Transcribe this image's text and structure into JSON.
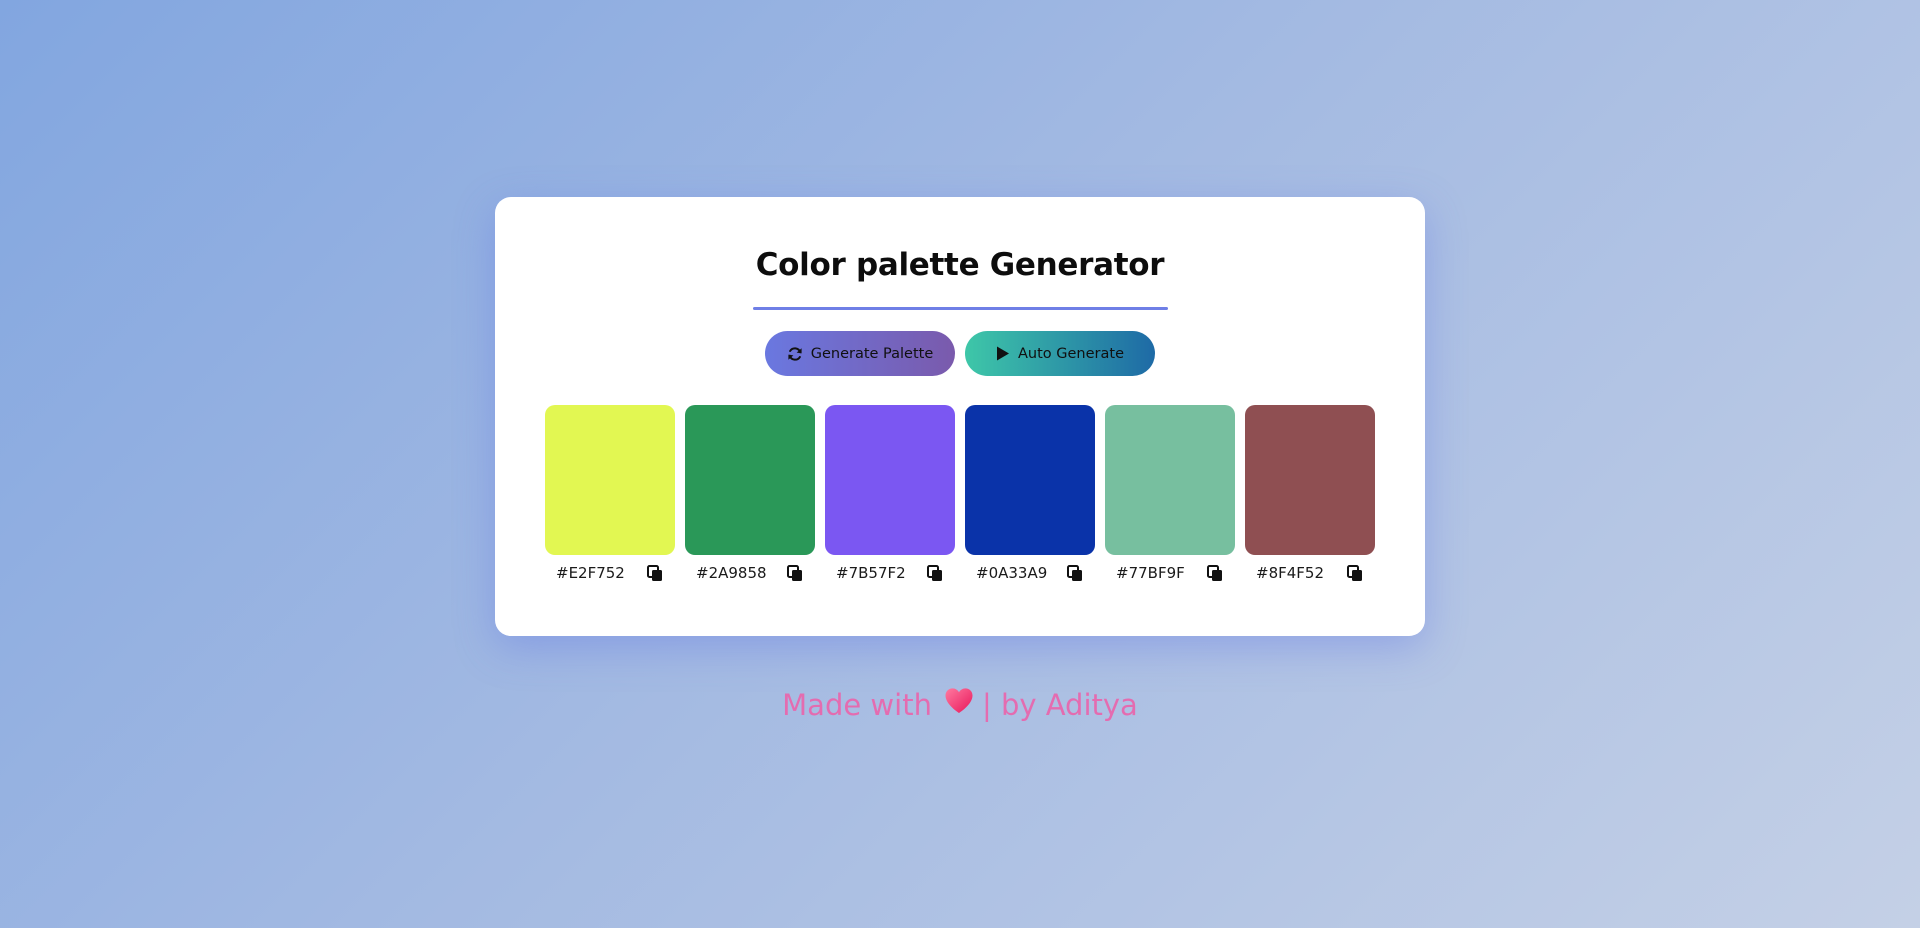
{
  "app": {
    "title": "Color palette Generator"
  },
  "buttons": {
    "generate_label": "Generate Palette",
    "generate_icon": "refresh-icon",
    "auto_label": "Auto Generate",
    "auto_icon": "play-icon"
  },
  "palette": [
    {
      "hex": "#E2F752",
      "color": "#E2F752"
    },
    {
      "hex": "#2A9858",
      "color": "#2A9858"
    },
    {
      "hex": "#7B57F2",
      "color": "#7B57F2"
    },
    {
      "hex": "#0A33A9",
      "color": "#0A33A9"
    },
    {
      "hex": "#77BF9F",
      "color": "#77BF9F"
    },
    {
      "hex": "#8F4F52",
      "color": "#8F4F52"
    }
  ],
  "copy_icon": "copy-icon",
  "footer": {
    "prefix": "Made with",
    "icon": "heart-icon",
    "suffix": "| by Aditya"
  },
  "colors": {
    "accent": "#6F7FE6",
    "footer_text": "#E46CB0",
    "card_bg": "#FFFFFF"
  }
}
